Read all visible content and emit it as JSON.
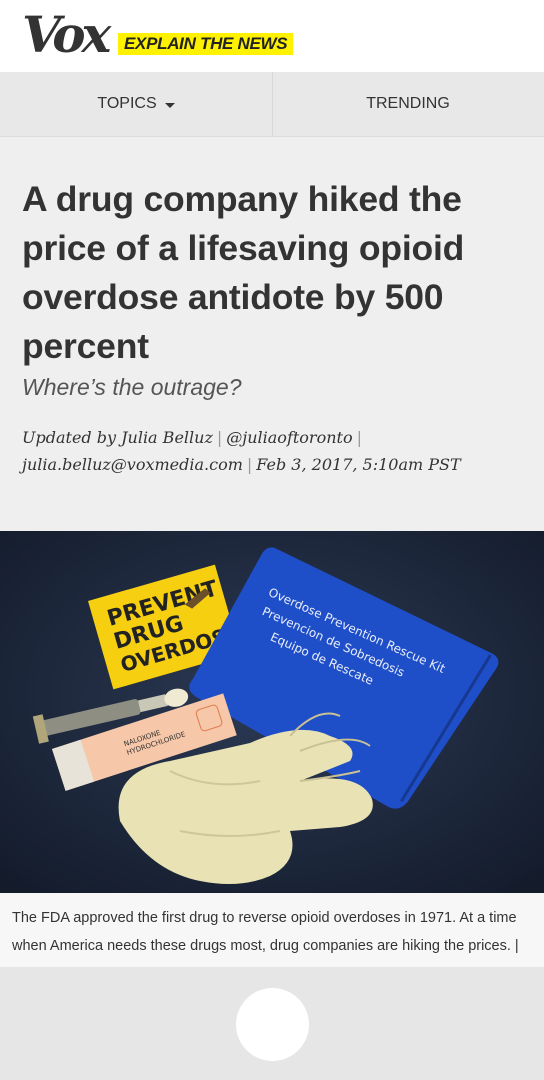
{
  "header": {
    "logo_text": "Vox",
    "tagline": "EXPLAIN THE NEWS"
  },
  "nav": {
    "topics_label": "TOPICS",
    "trending_label": "TRENDING"
  },
  "article": {
    "headline": "A drug company hiked the price of a lifesaving opioid overdose antidote by 500 percent",
    "dek": "Where’s the outrage?",
    "byline": {
      "updated_by": "Updated by Julia Belluz",
      "twitter": "@juliaoftoronto",
      "email": "julia.belluz@voxmedia.com",
      "date": "Feb 3, 2017, 5:10am PST"
    }
  },
  "hero_image": {
    "sign_line1": "PREVENT",
    "sign_line2": "DRUG",
    "sign_line3": "OVERDOSE",
    "kit_line1": "Overdose Prevention Rescue Kit",
    "kit_line2": "Prevencion de Sobredosis",
    "kit_line3": "Equipo de Rescate",
    "box_label_1": "NALOXONE",
    "box_label_2": "HYDROCHLORIDE"
  },
  "caption": {
    "text": "The FDA approved the first drug to reverse opioid overdoses in 1971. At a time when America needs these drugs most, drug companies are hiking the prices. | Andrew Burton/Getty Images"
  },
  "colors": {
    "brand_yellow": "#fff200",
    "text_dark": "#333333",
    "kit_blue": "#1f4fc8",
    "background_gray": "#efefef"
  },
  "icons": {
    "caret": "chevron-down-icon",
    "home": "home-button-circle"
  }
}
